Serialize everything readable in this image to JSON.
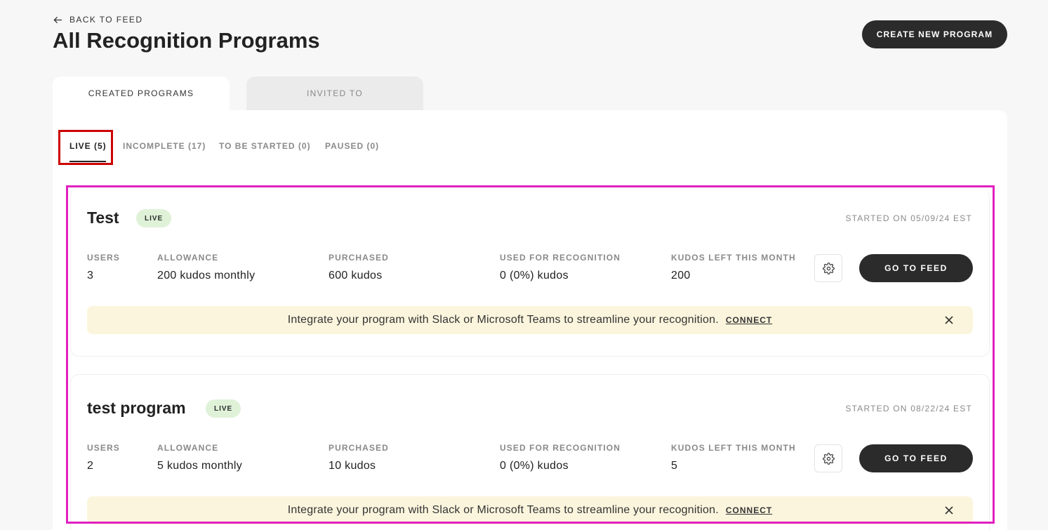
{
  "header": {
    "back_label": "BACK TO FEED",
    "title": "All Recognition Programs",
    "create_button": "CREATE NEW PROGRAM"
  },
  "tabs": {
    "created": "CREATED PROGRAMS",
    "invited": "INVITED TO",
    "active": "created"
  },
  "subtabs": [
    {
      "label": "LIVE (5)",
      "active": true
    },
    {
      "label": "INCOMPLETE (17)",
      "active": false
    },
    {
      "label": "TO BE STARTED (0)",
      "active": false
    },
    {
      "label": "PAUSED (0)",
      "active": false
    }
  ],
  "stat_labels": {
    "users": "USERS",
    "allowance": "ALLOWANCE",
    "purchased": "PURCHASED",
    "used": "USED FOR RECOGNITION",
    "left": "KUDOS LEFT THIS MONTH"
  },
  "programs": [
    {
      "name": "Test",
      "status": "LIVE",
      "started": "STARTED ON 05/09/24 EST",
      "users": "3",
      "allowance": "200 kudos monthly",
      "purchased": "600 kudos",
      "used": "0 (0%) kudos",
      "left": "200",
      "feed_button": "GO TO FEED",
      "banner_text": "Integrate your program with Slack or Microsoft Teams to streamline your recognition.",
      "banner_link": "CONNECT"
    },
    {
      "name": "test program",
      "status": "LIVE",
      "started": "STARTED ON 08/22/24 EST",
      "users": "2",
      "allowance": "5 kudos monthly",
      "purchased": "10 kudos",
      "used": "0 (0%) kudos",
      "left": "5",
      "feed_button": "GO TO FEED",
      "banner_text": "Integrate your program with Slack or Microsoft Teams to streamline your recognition.",
      "banner_link": "CONNECT"
    }
  ],
  "colors": {
    "primary_button": "#2b2b2b",
    "live_badge_bg": "#dff2d8",
    "banner_bg": "#fbf5dd",
    "highlight_red": "#cc0000",
    "highlight_magenta": "#e020c0"
  }
}
